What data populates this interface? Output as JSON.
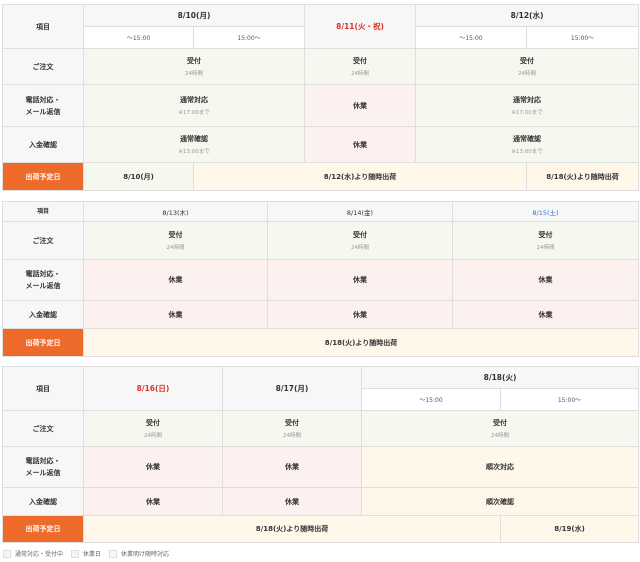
{
  "labels": {
    "item": "項目",
    "order": "ご注文",
    "phone_line1": "電話対応・",
    "phone_line2": "メール返信",
    "payment": "入金確認",
    "shipping": "出荷予定日"
  },
  "week1": {
    "d1": "8/10(月)",
    "d2": "8/11(火・祝)",
    "d3": "8/12(水)",
    "before": "～15:00",
    "after": "15:00～",
    "order_main": "受付",
    "order_sub": "24時間",
    "phone_normal": "通常対応",
    "phone_note": "※17:00まで",
    "closed": "休業",
    "pay_normal": "通常確認",
    "pay_note": "※13:00まで",
    "ship1": "8/10(月)",
    "ship2": "8/12(水)より随時出荷",
    "ship3": "8/18(火)より随時出荷"
  },
  "week2": {
    "d1": "8/13(木)",
    "d2": "8/14(金)",
    "d3": "8/15(土)",
    "order_main": "受付",
    "order_sub": "24時間",
    "closed": "休業",
    "ship": "8/18(火)より随時出荷"
  },
  "week3": {
    "d1": "8/16(日)",
    "d2": "8/17(月)",
    "d3": "8/18(火)",
    "before": "～15:00",
    "after": "15:00～",
    "order_main": "受付",
    "order_sub": "24時間",
    "closed": "休業",
    "phone_seq": "順次対応",
    "pay_seq": "順次確認",
    "ship1": "8/18(火)より随時出荷",
    "ship2": "8/19(水)"
  },
  "legend": {
    "normal": "通常対応・受付中",
    "holiday": "休業日",
    "after_holiday": "休業明け随時対応"
  },
  "colors": {
    "accent": "#ed6a2a",
    "normal_bg": "#f5f8ef",
    "holiday_bg": "#fdf1f0",
    "after_holiday_bg": "#fff8ea",
    "holiday_text": "#d9352b",
    "saturday_text": "#3b6fc4"
  }
}
